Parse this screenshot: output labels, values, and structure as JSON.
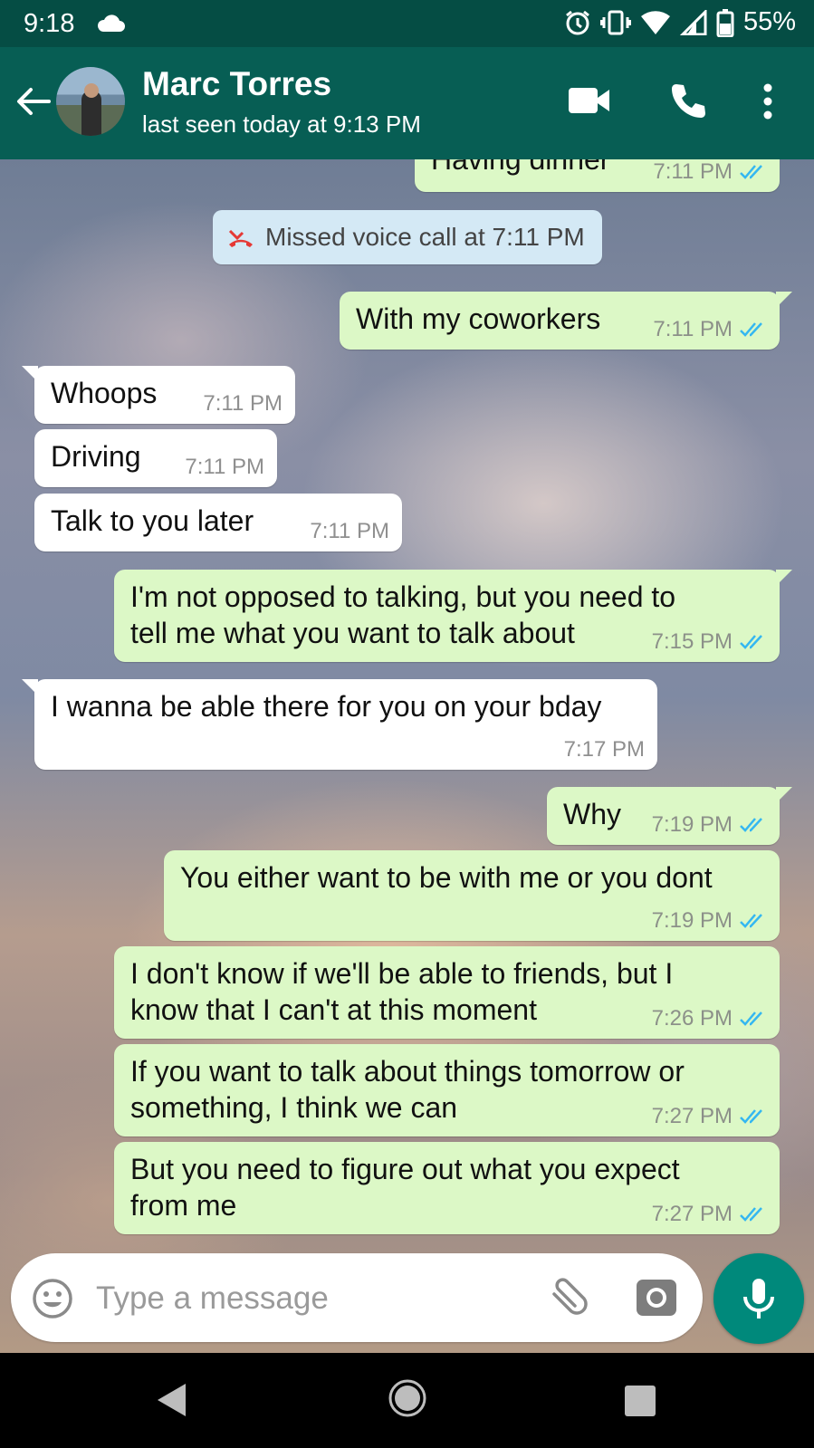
{
  "status_bar": {
    "time": "9:18",
    "battery": "55%"
  },
  "header": {
    "contact_name": "Marc Torres",
    "status": "last seen today at 9:13 PM"
  },
  "system_message": {
    "text": "Missed voice call at 7:11 PM"
  },
  "messages": [
    {
      "direction": "out",
      "text": "Having dinner",
      "time": "7:11 PM",
      "ticks": "read"
    },
    {
      "direction": "out",
      "text": "With my coworkers",
      "time": "7:11 PM",
      "ticks": "read"
    },
    {
      "direction": "in",
      "text": "Whoops",
      "time": "7:11 PM"
    },
    {
      "direction": "in",
      "text": "Driving",
      "time": "7:11 PM"
    },
    {
      "direction": "in",
      "text": "Talk to you later",
      "time": "7:11 PM"
    },
    {
      "direction": "out",
      "line1": "I'm not opposed to talking, but you need to",
      "line2": "tell me what you want to talk about",
      "time": "7:15 PM",
      "ticks": "read"
    },
    {
      "direction": "in",
      "text": "I wanna be able there for you on your bday",
      "time": "7:17 PM"
    },
    {
      "direction": "out",
      "text": "Why",
      "time": "7:19 PM",
      "ticks": "read"
    },
    {
      "direction": "out",
      "text": "You either want to be with me or you dont",
      "time": "7:19 PM",
      "ticks": "read"
    },
    {
      "direction": "out",
      "line1": "I don't know if we'll be able to friends, but I",
      "line2": "know that I can't at this moment",
      "time": "7:26 PM",
      "ticks": "read"
    },
    {
      "direction": "out",
      "line1": "If you want to talk about things tomorrow or",
      "line2": "something, I think we can",
      "time": "7:27 PM",
      "ticks": "read"
    },
    {
      "direction": "out",
      "line1": "But you need to figure out what you expect",
      "line2": "from me",
      "time": "7:27 PM",
      "ticks": "read"
    }
  ],
  "composer": {
    "placeholder": "Type a message"
  },
  "colors": {
    "app_bar": "#075e54",
    "outgoing_bubble": "#dcf8c6",
    "incoming_bubble": "#ffffff",
    "read_ticks": "#34b7f1",
    "mic_button": "#00897b",
    "missed_call": "#e53935"
  },
  "icons": {
    "back": "arrow-left-icon",
    "video": "video-camera-icon",
    "call": "phone-icon",
    "menu": "more-vert-icon",
    "emoji": "emoji-icon",
    "attach": "paperclip-icon",
    "camera": "camera-icon",
    "mic": "microphone-icon"
  }
}
